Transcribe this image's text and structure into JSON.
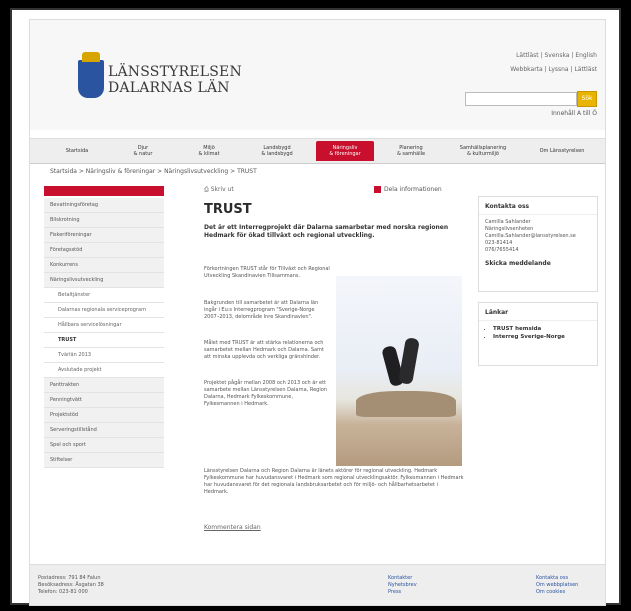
{
  "header": {
    "logo": {
      "line1": "LÄNSSTYRELSEN",
      "line2": "DALARNAS LÄN"
    },
    "toplinks_row1": "Lättläst | Svenska | English",
    "toplinks_row2": "Webbkarta | Lyssna | Lättläst",
    "search_button": "Sök",
    "az_link": "Innehåll A till Ö"
  },
  "nav": {
    "items": [
      "Startsida",
      "Djur\n& natur",
      "Miljö\n& klimat",
      "Landsbygd\n& landsbygd",
      "Näringsliv\n& föreningar",
      "Planering\n& samhälle",
      "Samhällsplanering\n& kulturmiljö",
      "Om Länsstyrelsen"
    ]
  },
  "breadcrumb": "Startsida > Näringsliv & föreningar > Näringslivsutveckling > TRUST",
  "leftmenu": {
    "items": [
      "Bevattningsföretag",
      "Bilskrotning",
      "Fiskeriföreningar",
      "Företagsstöd",
      "Konkurrens",
      "Näringslivsutveckling",
      "Betaltjänster",
      "Dalarnas regionala serviceprogram",
      "Hållbara servicelösningar",
      "TRUST",
      "Tvärlän 2013",
      "Avslutade projekt",
      "Panttrakten",
      "Penningtvätt",
      "Projektstöd",
      "Serveringstillstånd",
      "Spel och sport",
      "Stiftelser"
    ]
  },
  "content": {
    "print": "Skriv ut",
    "share": "Dela informationen",
    "title": "TRUST",
    "lead": "Det är ett Interregprojekt där Dalarna samarbetar med norska regionen Hedmark för ökad tillväxt och regional utveckling.",
    "p1": "Förkortningen TRUST står för Tillväxt och Regional Utveckling Skandinavien Tillsammans.",
    "p2": "Bakgrunden till samarbetet är att Dalarna län ingår i Eu:s Interregprogram \"Sverige-Norge 2007–2013, delområde Inre Skandinavien\".",
    "p3": "Målet med TRUST är att stärka relationerna och samarbetet mellan Hedmark och Dalarna. Samt att minska upplevda och verkliga gränshinder.",
    "p4": "Projektet pågår mellan 2008 och 2013 och är ett samarbete mellan Länsstyrelsen Dalarna, Region Dalarna, Hedmark Fylkeskommune, Fylkesmannen i Hedmark.",
    "p5": "Länsstyrelsen Dalarna och Region Dalarna är länets aktörer för regional utveckling. Hedmark Fylkeskommune har huvudansvaret i Hedmark som regional utvecklingsaktör. Fylkesmannen i Hedmark har huvudansvaret för det regionala landsbruksarbetet och för miljö- och hållbarhetsarbetet i Hedmark.",
    "comment": "Kommentera sidan"
  },
  "contact": {
    "heading": "Kontakta oss",
    "lines": [
      "Camilla Sahlander",
      "Näringslivsenheten",
      "Camilla.Sahlander@lansstyrelsen.se",
      "023-81414",
      "076/7655414"
    ],
    "send": "Skicka meddelande"
  },
  "links": {
    "heading": "Länkar",
    "items": [
      "TRUST hemsida",
      "Interreg Sverige-Norge"
    ]
  },
  "footer": {
    "address": [
      "Postadress: 791 84 Falun",
      "Besöksadress: Åsgatan 38",
      "Telefon: 023-81 000"
    ],
    "col1": [
      "Kontakter",
      "Nyhetsbrev",
      "Press"
    ],
    "col2": [
      "Kontakta oss",
      "Om webbplatsen",
      "Om cookies"
    ]
  }
}
